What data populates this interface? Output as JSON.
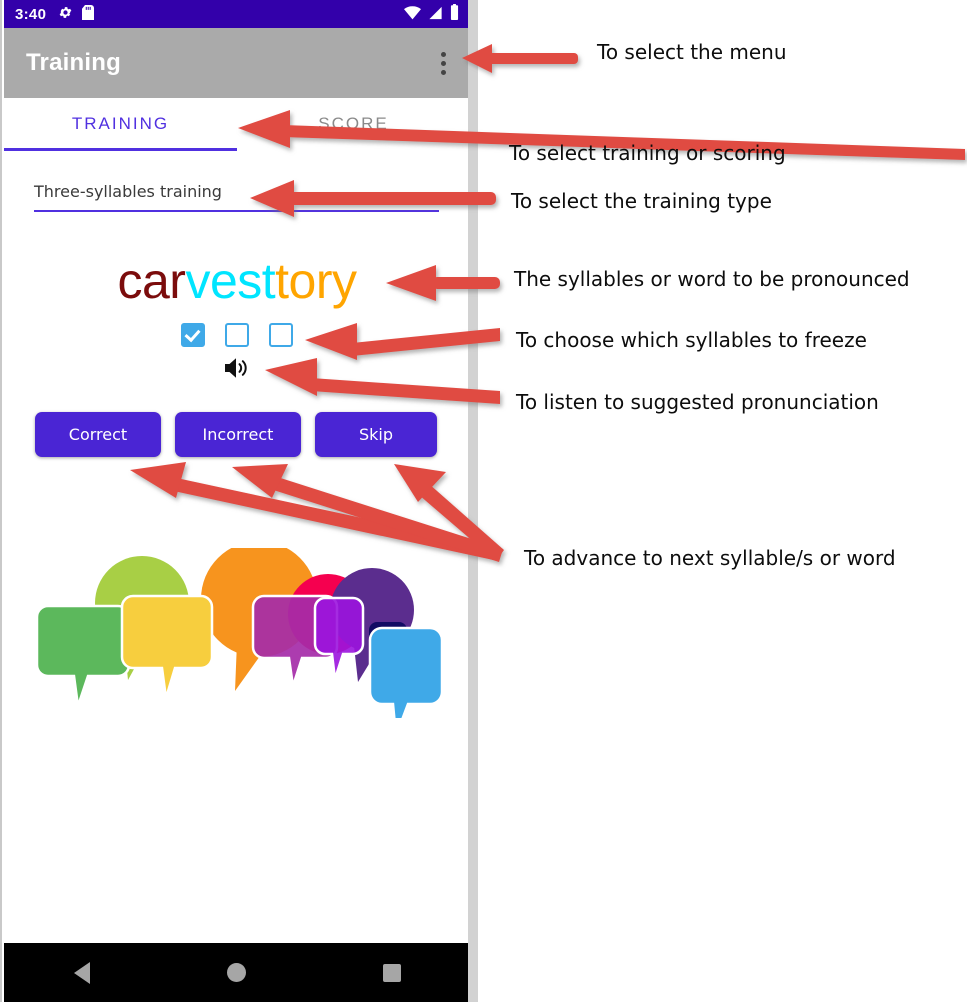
{
  "device": {
    "statusbar": {
      "clock": "3:40",
      "icons_left": [
        "gear-icon",
        "sd-card-icon"
      ],
      "icons_right": [
        "wifi-icon",
        "cellular-signal-icon",
        "battery-icon"
      ],
      "background_color": "#3300AA"
    },
    "appbar": {
      "title": "Training",
      "overflow_menu": "overflow-menu-icon",
      "background_color": "#AAAAAA"
    },
    "navbar": {
      "back": "back-triangle-icon",
      "home": "home-circle-icon",
      "recents": "recents-square-icon",
      "background_color": "#000000"
    }
  },
  "app": {
    "tabs": [
      {
        "label": "TRAINING",
        "active": true
      },
      {
        "label": "SCORE",
        "active": false
      }
    ],
    "accent_color": "#5030E0",
    "spinner": {
      "label": "training-type-spinner",
      "value": "Three-syllables training"
    },
    "word": {
      "syllables": [
        {
          "text": "car",
          "color": "#7B0C0C"
        },
        {
          "text": "vest",
          "color": "#00E5FF"
        },
        {
          "text": "tory",
          "color": "#FFA500"
        }
      ],
      "full_text": "carvesttory"
    },
    "freeze_checkboxes": [
      {
        "checked": true
      },
      {
        "checked": false
      },
      {
        "checked": false
      }
    ],
    "checkbox_color": "#3FA9E8",
    "speaker_button": "speaker-volume-icon",
    "buttons": [
      {
        "id": "correct",
        "label": "Correct"
      },
      {
        "id": "incorrect",
        "label": "Incorrect"
      },
      {
        "id": "skip",
        "label": "Skip"
      }
    ],
    "button_color": "#4A25D4",
    "illustration": {
      "name": "speech-bubbles-illustration",
      "bubble_colors": [
        "#5CB85C",
        "#A8CF45",
        "#F7CE3E",
        "#F7941E",
        "#F5004F",
        "#A52BA8",
        "#5B2D8E",
        "#3FA9E8"
      ]
    }
  },
  "annotations": [
    {
      "id": "menu",
      "text": "To select the menu"
    },
    {
      "id": "tabs",
      "text": "To select training or scoring"
    },
    {
      "id": "type",
      "text": "To select the training type"
    },
    {
      "id": "word",
      "text": "The syllables or word to be pronounced"
    },
    {
      "id": "freeze",
      "text": "To choose which syllables to freeze"
    },
    {
      "id": "listen",
      "text": "To listen to suggested pronunciation"
    },
    {
      "id": "advance",
      "text": "To advance to next syllable/s or word"
    }
  ],
  "annotation_arrow_color": "#E04B43"
}
